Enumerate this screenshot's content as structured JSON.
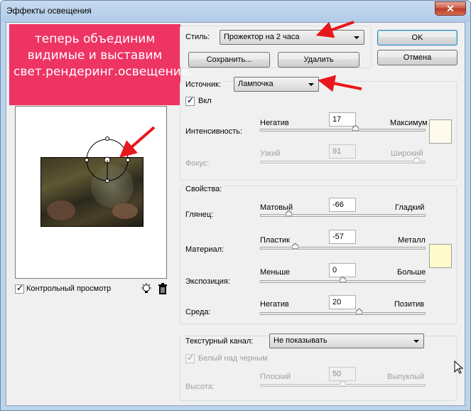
{
  "window": {
    "title": "Эффекты освещения",
    "close_glyph": "✕"
  },
  "preset": {
    "style_label": "Стиль:",
    "style_value": "Прожектор на 2 часа",
    "save_label": "Сохранить...",
    "delete_label": "Удалить"
  },
  "buttons": {
    "ok": "OK",
    "cancel": "Отмена"
  },
  "annotation": {
    "text": "теперь объединим видимые и выставим свет.рендеринг.освещение."
  },
  "light": {
    "source_label": "Источник:",
    "source_value": "Лампочка",
    "on_label": "Вкл",
    "on_checked": true,
    "intensity": {
      "label": "Интенсивность:",
      "min_label": "Негатив",
      "max_label": "Максимум",
      "value": "17",
      "fraction": 0.58
    },
    "focus": {
      "label": "Фокус:",
      "min_label": "Узкий",
      "max_label": "Широкий",
      "value": "91",
      "fraction": 0.95,
      "disabled": true
    },
    "color": "#fffbec"
  },
  "properties": {
    "title": "Свойства:",
    "gloss": {
      "label": "Глянец:",
      "min_label": "Матовый",
      "max_label": "Гладкий",
      "value": "-66",
      "fraction": 0.17
    },
    "material": {
      "label": "Материал:",
      "min_label": "Пластик",
      "max_label": "Металл",
      "value": "-57",
      "fraction": 0.21
    },
    "exposure": {
      "label": "Экспозиция:",
      "min_label": "Меньше",
      "max_label": "Больше",
      "value": "0",
      "fraction": 0.5
    },
    "ambience": {
      "label": "Среда:",
      "min_label": "Негатив",
      "max_label": "Позитив",
      "value": "20",
      "fraction": 0.6
    },
    "color": "#fffbcf"
  },
  "texture": {
    "channel_label": "Текстурный канал:",
    "channel_value": "Не показывать",
    "white_high_label": "Белый над черным",
    "white_high_checked": true,
    "height": {
      "label": "Высота:",
      "min_label": "Плоский",
      "max_label": "Выпуклый",
      "value": "50",
      "fraction": 0.5
    }
  },
  "preview": {
    "label": "Контрольный просмотр",
    "checked": true
  },
  "icons": {
    "light_bulb": "light-bulb-icon",
    "trash": "trash-icon"
  },
  "colors": {
    "annotation_bg": "#ee3463",
    "arrow": "#e8171b"
  }
}
